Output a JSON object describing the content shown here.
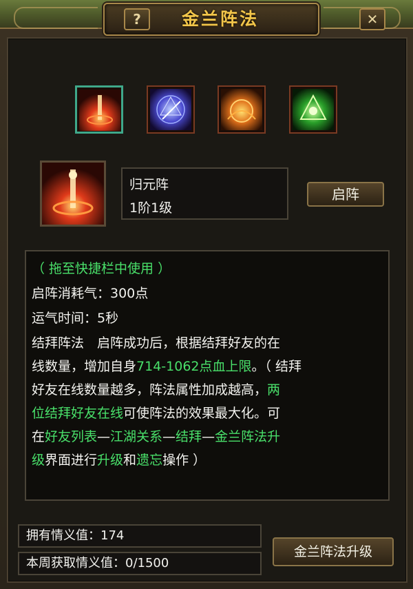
{
  "window": {
    "title": "金兰阵法",
    "help_label": "?",
    "close_label": "✕"
  },
  "formations": [
    {
      "icon": "flame-pillar-icon",
      "color": "#e03a1a",
      "selected": true
    },
    {
      "icon": "star-orb-icon",
      "color": "#4a6ae0",
      "selected": false
    },
    {
      "icon": "sun-shield-icon",
      "color": "#e0881a",
      "selected": false
    },
    {
      "icon": "green-triangle-icon",
      "color": "#3ac03a",
      "selected": false
    }
  ],
  "selected": {
    "name": "归元阵",
    "level": "1阶1级",
    "button_label": "启阵"
  },
  "description": {
    "line1": "（ 拖至快捷栏中使用 ）",
    "line2": "启阵消耗气：300点",
    "line3": "运气时间：5秒",
    "line4": "结拜阵法　启阵成功后，根据结拜好友的在",
    "line5_a": "线数量，增加自身",
    "line5_b": "714-1062点血上限",
    "line5_c": "。（ 结拜",
    "line6_a": "好友在线数量越多，阵法属性加成越高，",
    "line6_b": "两",
    "line7_a": "位结拜好友在线",
    "line7_b": "可使阵法的效果最大化。可",
    "line8_a": "在",
    "line8_b": "好友列表",
    "line8_c": "—",
    "line8_d": "江湖关系",
    "line8_e": "—",
    "line8_f": "结拜",
    "line8_g": "—",
    "line8_h": "金兰阵法升",
    "line9_a": "级",
    "line9_b": "界面进行",
    "line9_c": "升级",
    "line9_d": "和",
    "line9_e": "遗忘",
    "line9_f": "操作 ）"
  },
  "stats": {
    "owned_label": "拥有情义值：174",
    "weekly_label": "本周获取情义值：0/1500"
  },
  "upgrade_label": "金兰阵法升级",
  "colors": {
    "accent_gold": "#f2c64a",
    "highlight_green": "#49e06a",
    "text": "#f2f2ee"
  }
}
